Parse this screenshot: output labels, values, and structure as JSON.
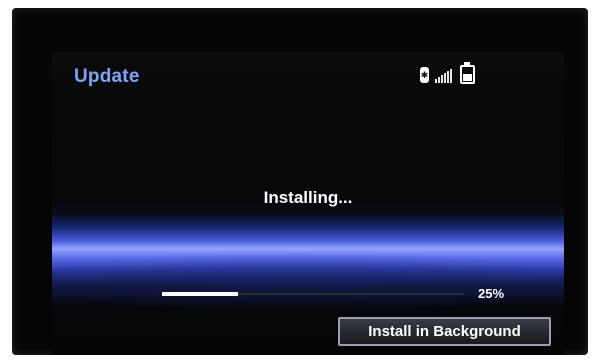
{
  "header": {
    "title": "Update",
    "status_icons": [
      "bluetooth-icon",
      "signal-strength-icon",
      "battery-icon"
    ]
  },
  "main": {
    "status_text": "Installing...",
    "progress": {
      "value": 25,
      "label": "25%"
    },
    "background_button_label": "Install in Background"
  },
  "colors": {
    "title": "#7fa2f6",
    "text": "#ffffff",
    "glow": "#4557d8",
    "background": "#050505"
  }
}
